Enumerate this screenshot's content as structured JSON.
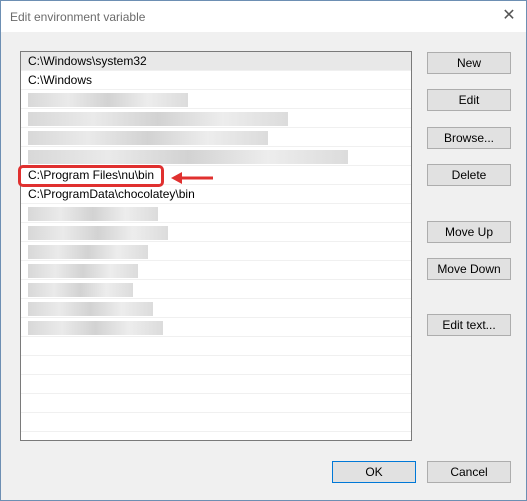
{
  "window": {
    "title": "Edit environment variable",
    "close_glyph": "✕"
  },
  "paths": [
    "C:\\Windows\\system32",
    "C:\\Windows",
    "",
    "",
    "",
    "",
    "C:\\Program Files\\nu\\bin",
    "C:\\ProgramData\\chocolatey\\bin",
    "",
    "",
    "",
    "",
    "",
    "",
    "",
    "",
    "",
    "",
    "",
    "",
    ""
  ],
  "buttons": {
    "new": "New",
    "edit": "Edit",
    "browse": "Browse...",
    "delete": "Delete",
    "move_up": "Move Up",
    "move_down": "Move Down",
    "edit_text": "Edit text...",
    "ok": "OK",
    "cancel": "Cancel"
  },
  "annotation": {
    "color": "#e0302f"
  }
}
